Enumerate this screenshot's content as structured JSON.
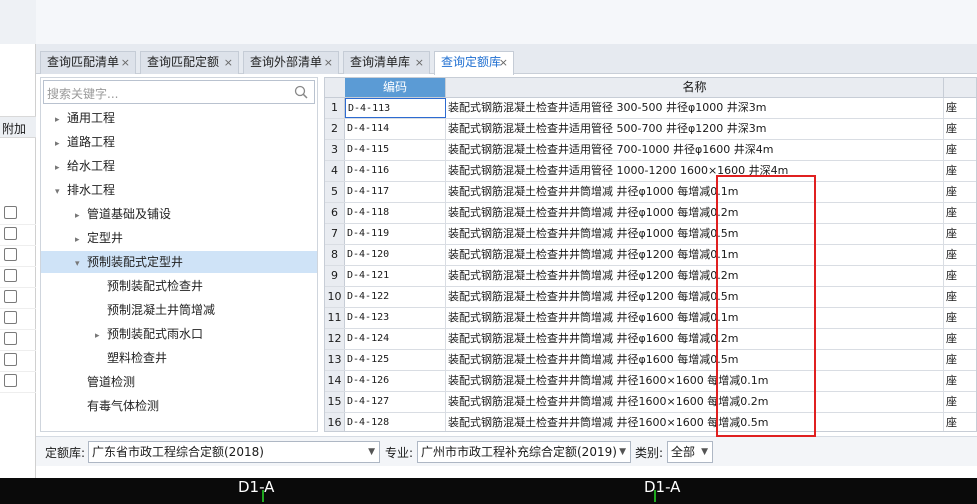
{
  "left_panel": {
    "column_header": "附加",
    "checkbox_count": 9
  },
  "tabs": [
    {
      "label": "查询匹配清单",
      "active": false
    },
    {
      "label": "查询匹配定额",
      "active": false
    },
    {
      "label": "查询外部清单",
      "active": false
    },
    {
      "label": "查询清单库",
      "active": false
    },
    {
      "label": "查询定额库",
      "active": true
    }
  ],
  "tab_close": "×",
  "search": {
    "placeholder": "搜索关键字..."
  },
  "tree": [
    {
      "label": "通用工程",
      "arrow": "▸",
      "level": 0
    },
    {
      "label": "道路工程",
      "arrow": "▸",
      "level": 0
    },
    {
      "label": "给水工程",
      "arrow": "▸",
      "level": 0
    },
    {
      "label": "排水工程",
      "arrow": "▾",
      "level": 0
    },
    {
      "label": "管道基础及铺设",
      "arrow": "▸",
      "level": 1
    },
    {
      "label": "定型井",
      "arrow": "▸",
      "level": 1
    },
    {
      "label": "预制装配式定型井",
      "arrow": "▾",
      "level": 1,
      "selected": true
    },
    {
      "label": "预制装配式检查井",
      "arrow": "",
      "level": 2
    },
    {
      "label": "预制混凝土井筒增减",
      "arrow": "",
      "level": 2
    },
    {
      "label": "预制装配式雨水口",
      "arrow": "▸",
      "level": 2
    },
    {
      "label": "塑料检查井",
      "arrow": "",
      "level": 2
    },
    {
      "label": "管道检测",
      "arrow": "",
      "level": 1
    },
    {
      "label": "有毒气体检测",
      "arrow": "",
      "level": 1
    }
  ],
  "grid": {
    "headers": {
      "code": "编码",
      "name": "名称"
    },
    "rows": [
      {
        "n": "1",
        "code": "D-4-113",
        "name": "装配式钢筋混凝土检查井适用管径 300-500 井径φ1000 井深3m",
        "unit": "座"
      },
      {
        "n": "2",
        "code": "D-4-114",
        "name": "装配式钢筋混凝土检查井适用管径 500-700 井径φ1200 井深3m",
        "unit": "座"
      },
      {
        "n": "3",
        "code": "D-4-115",
        "name": "装配式钢筋混凝土检查井适用管径 700-1000 井径φ1600 井深4m",
        "unit": "座"
      },
      {
        "n": "4",
        "code": "D-4-116",
        "name": "装配式钢筋混凝土检查井适用管径 1000-1200 1600×1600 井深4m",
        "unit": "座"
      },
      {
        "n": "5",
        "code": "D-4-117",
        "name": "装配式钢筋混凝土检查井井筒增减 井径φ1000 每增减0.1m",
        "unit": "座"
      },
      {
        "n": "6",
        "code": "D-4-118",
        "name": "装配式钢筋混凝土检查井井筒增减 井径φ1000 每增减0.2m",
        "unit": "座"
      },
      {
        "n": "7",
        "code": "D-4-119",
        "name": "装配式钢筋混凝土检查井井筒增减 井径φ1000 每增减0.5m",
        "unit": "座"
      },
      {
        "n": "8",
        "code": "D-4-120",
        "name": "装配式钢筋混凝土检查井井筒增减 井径φ1200 每增减0.1m",
        "unit": "座"
      },
      {
        "n": "9",
        "code": "D-4-121",
        "name": "装配式钢筋混凝土检查井井筒增减 井径φ1200 每增减0.2m",
        "unit": "座"
      },
      {
        "n": "10",
        "code": "D-4-122",
        "name": "装配式钢筋混凝土检查井井筒增减 井径φ1200 每增减0.5m",
        "unit": "座"
      },
      {
        "n": "11",
        "code": "D-4-123",
        "name": "装配式钢筋混凝土检查井井筒增减 井径φ1600 每增减0.1m",
        "unit": "座"
      },
      {
        "n": "12",
        "code": "D-4-124",
        "name": "装配式钢筋混凝土检查井井筒增减 井径φ1600 每增减0.2m",
        "unit": "座"
      },
      {
        "n": "13",
        "code": "D-4-125",
        "name": "装配式钢筋混凝土检查井井筒增减 井径φ1600 每增减0.5m",
        "unit": "座"
      },
      {
        "n": "14",
        "code": "D-4-126",
        "name": "装配式钢筋混凝土检查井井筒增减 井径1600×1600 每增减0.1m",
        "unit": "座"
      },
      {
        "n": "15",
        "code": "D-4-127",
        "name": "装配式钢筋混凝土检查井井筒增减 井径1600×1600 每增减0.2m",
        "unit": "座"
      },
      {
        "n": "16",
        "code": "D-4-128",
        "name": "装配式钢筋混凝土检查井井筒增减 井径1600×1600 每增减0.5m",
        "unit": "座"
      }
    ]
  },
  "filter": {
    "library_label": "定额库:",
    "library_value": "广东省市政工程综合定额(2018)",
    "major_label": "专业:",
    "major_value": "广州市市政工程补充综合定额(2019)",
    "category_label": "类别:",
    "category_value": "全部"
  },
  "bottom_bar": {
    "label_left": "D1-A",
    "label_right": "D1-A"
  },
  "colors": {
    "accent": "#1f6fd1",
    "header_blue": "#5b9bd5",
    "highlight_box": "#e02020",
    "tree_selected": "#cfe3f7"
  }
}
